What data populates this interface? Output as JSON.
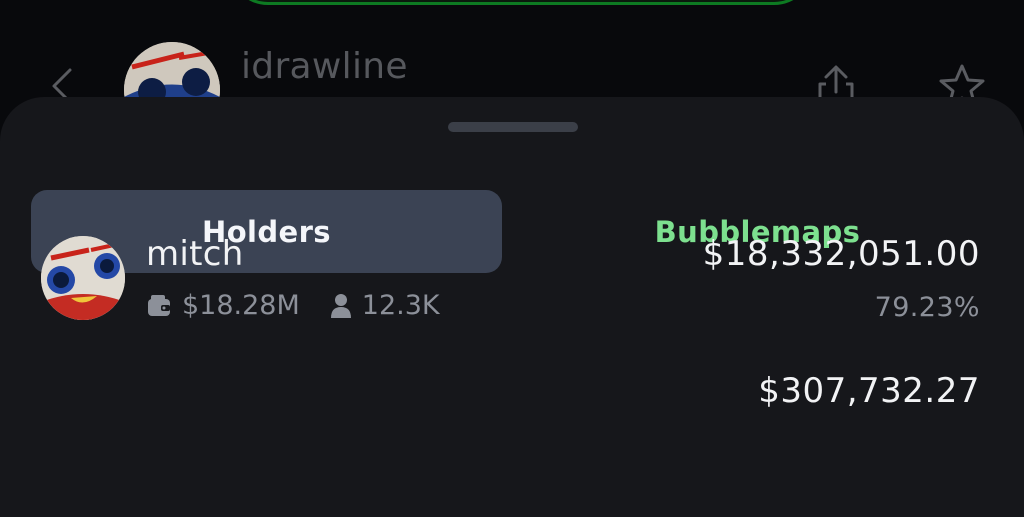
{
  "header": {
    "username": "idrawline",
    "icons": {
      "back": "chevron-left-icon",
      "share": "share-icon",
      "favorite": "star-icon"
    }
  },
  "tabs": {
    "items": [
      {
        "label": "Holders",
        "selected": true
      },
      {
        "label": "Bubblemaps",
        "selected": false
      }
    ],
    "accent_color": "#7de08f",
    "selected_bg": "#3b4354"
  },
  "holders": [
    {
      "name": "mitch",
      "wallet_value": "$18.28M",
      "followers": "12.3K",
      "amount": "$18,332,051.00",
      "percent": "79.23%",
      "icons": {
        "wallet": "wallet-icon",
        "followers": "person-icon"
      }
    },
    {
      "amount": "$307,732.27"
    }
  ]
}
